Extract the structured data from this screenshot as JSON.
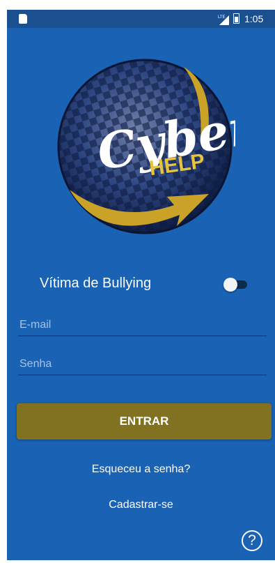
{
  "status_bar": {
    "time": "1:05",
    "network": "LTE",
    "icons": [
      "sd-card-icon",
      "signal-icon",
      "battery-icon"
    ]
  },
  "logo": {
    "name": "Cyber",
    "subtitle": "HELP",
    "colors": {
      "globe": "#1c3b78",
      "arrow": "#c9a227",
      "text": "#ffffff"
    }
  },
  "form": {
    "bullying_toggle_label": "Vítima de Bullying",
    "bullying_toggle_on": false,
    "email_placeholder": "E-mail",
    "email_value": "",
    "password_placeholder": "Senha",
    "password_value": "",
    "enter_label": "ENTRAR",
    "forgot_password_label": "Esqueceu a senha?",
    "register_label": "Cadastrar-se",
    "help_label": "?"
  },
  "colors": {
    "background": "#1962b4",
    "status_bar": "#1a4f90",
    "button": "#807220",
    "underline": "#0d2a4f"
  }
}
